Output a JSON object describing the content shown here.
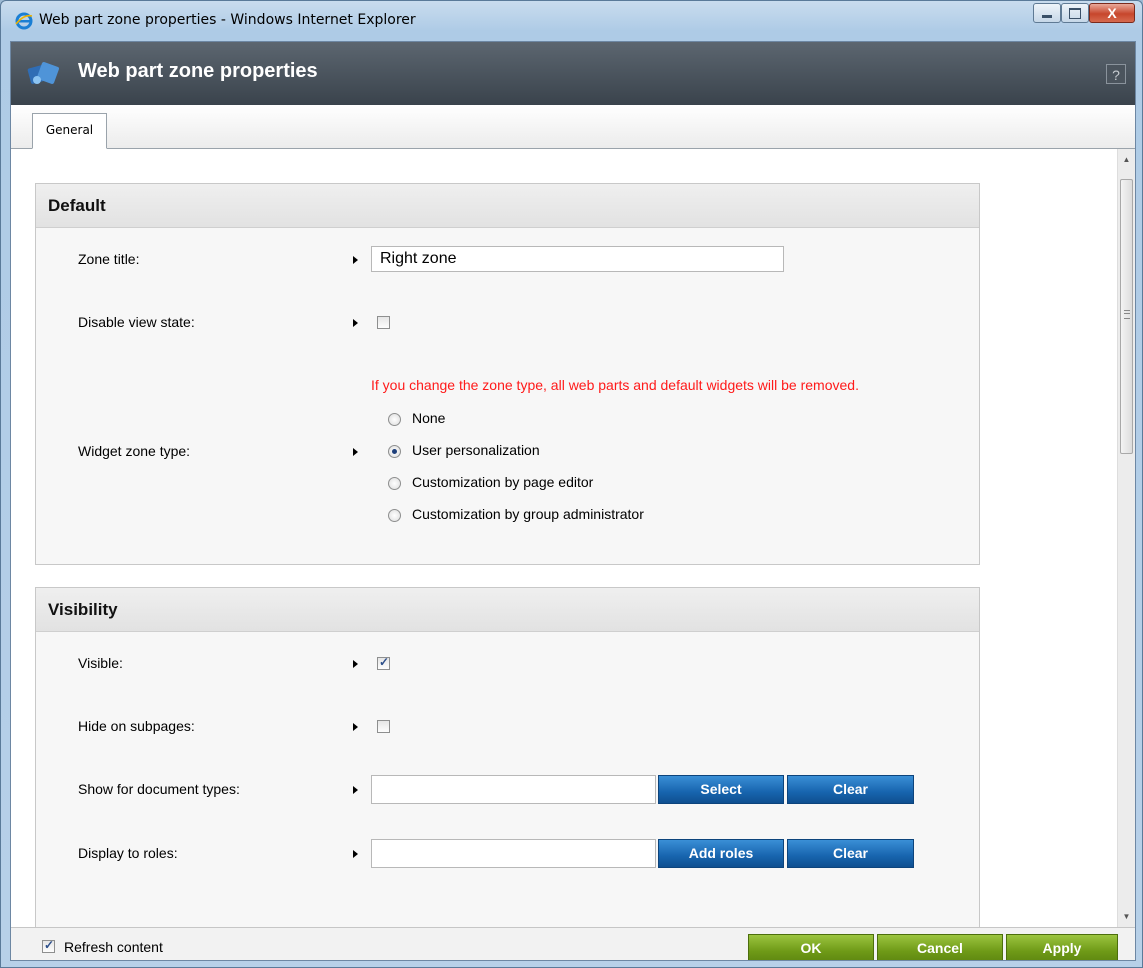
{
  "window": {
    "title": "Web part zone properties - Windows Internet Explorer",
    "close_glyph": "X"
  },
  "dialog": {
    "title": "Web part zone properties",
    "help_glyph": "?"
  },
  "tabs": [
    {
      "label": "General",
      "selected": true
    }
  ],
  "sections": {
    "default": {
      "heading": "Default",
      "zone_title_label": "Zone title:",
      "zone_title_value": "Right zone",
      "disable_view_state_label": "Disable view state:",
      "disable_view_state_checked": false,
      "zone_type_warning": "If you change the zone type, all web parts and default widgets will be removed.",
      "widget_zone_type_label": "Widget zone type:",
      "widget_zone_type_options": [
        {
          "label": "None",
          "selected": false
        },
        {
          "label": "User personalization",
          "selected": true
        },
        {
          "label": "Customization by page editor",
          "selected": false
        },
        {
          "label": "Customization by group administrator",
          "selected": false
        }
      ]
    },
    "visibility": {
      "heading": "Visibility",
      "visible_label": "Visible:",
      "visible_checked": true,
      "hide_on_subpages_label": "Hide on subpages:",
      "hide_on_subpages_checked": false,
      "show_doc_types_label": "Show for document types:",
      "show_doc_types_value": "",
      "select_button": "Select",
      "clear_button": "Clear",
      "display_roles_label": "Display to roles:",
      "display_roles_value": "",
      "add_roles_button": "Add roles",
      "clear_roles_button": "Clear"
    }
  },
  "footer": {
    "refresh_label": "Refresh content",
    "refresh_checked": true,
    "ok": "OK",
    "cancel": "Cancel",
    "apply": "Apply"
  },
  "colors": {
    "header_bg": "#3f4851",
    "warning": "#ff1a1a",
    "blue_button": "#1764ae",
    "green_button": "#6f9a17"
  }
}
